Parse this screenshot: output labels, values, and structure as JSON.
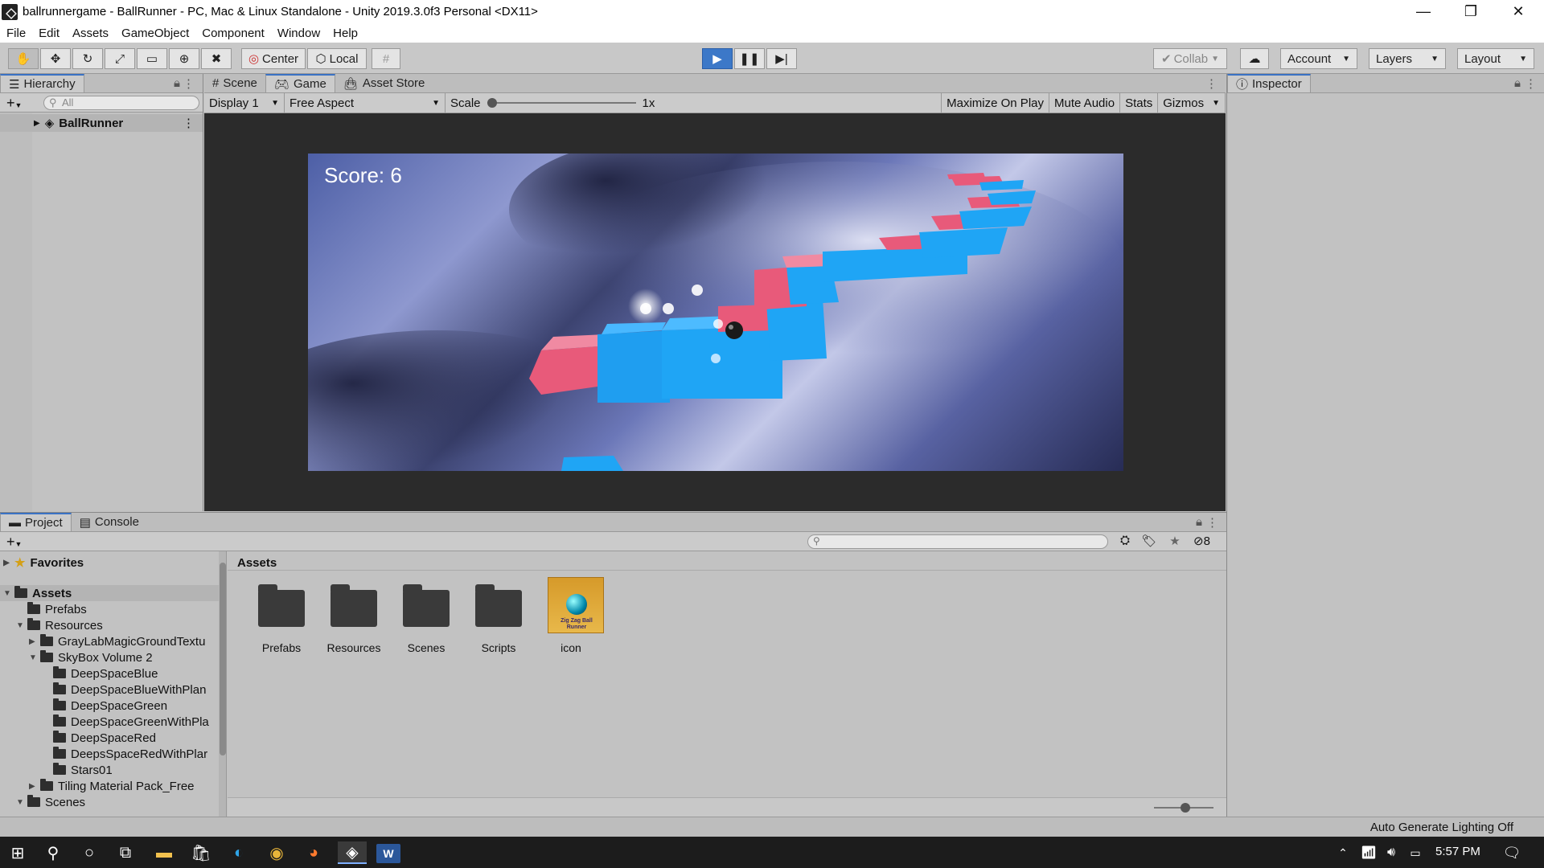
{
  "window": {
    "title": "ballrunnergame - BallRunner - PC, Mac & Linux Standalone - Unity 2019.3.0f3 Personal <DX11>",
    "minimize": "—",
    "maximize": "❐",
    "close": "✕"
  },
  "menu": [
    "File",
    "Edit",
    "Assets",
    "GameObject",
    "Component",
    "Window",
    "Help"
  ],
  "toolbar": {
    "tools": [
      "hand-tool-icon",
      "move-tool-icon",
      "rotate-tool-icon",
      "scale-tool-icon",
      "rect-tool-icon",
      "transform-tool-icon",
      "custom-tool-icon"
    ],
    "pivot_label": "Center",
    "space_label": "Local",
    "collab_label": "Collab",
    "account_label": "Account",
    "layers_label": "Layers",
    "layout_label": "Layout"
  },
  "hierarchy": {
    "tab": "Hierarchy",
    "search_placeholder": "All",
    "scene": "BallRunner"
  },
  "game": {
    "tabs": [
      "Scene",
      "Game",
      "Asset Store"
    ],
    "active_tab": "Game",
    "display": "Display 1",
    "aspect": "Free Aspect",
    "scale_label": "Scale",
    "scale_value": "1x",
    "scale_fraction": 0.0,
    "maximize": "Maximize On Play",
    "mute": "Mute Audio",
    "stats": "Stats",
    "gizmos": "Gizmos",
    "score_text": "Score: 6"
  },
  "inspector": {
    "tab": "Inspector"
  },
  "project": {
    "tabs": [
      "Project",
      "Console"
    ],
    "hidden_count": "8",
    "favorites": "Favorites",
    "tree": [
      {
        "label": "Assets",
        "depth": 0,
        "arrow": "▼",
        "folder": true
      },
      {
        "label": "Prefabs",
        "depth": 1,
        "arrow": "",
        "folder": true
      },
      {
        "label": "Resources",
        "depth": 1,
        "arrow": "▼",
        "folder": true
      },
      {
        "label": "GrayLabMagicGroundTextu",
        "depth": 2,
        "arrow": "▶",
        "folder": true
      },
      {
        "label": "SkyBox Volume 2",
        "depth": 2,
        "arrow": "▼",
        "folder": true
      },
      {
        "label": "DeepSpaceBlue",
        "depth": 3,
        "arrow": "",
        "folder": true
      },
      {
        "label": "DeepSpaceBlueWithPlan",
        "depth": 3,
        "arrow": "",
        "folder": true
      },
      {
        "label": "DeepSpaceGreen",
        "depth": 3,
        "arrow": "",
        "folder": true
      },
      {
        "label": "DeepSpaceGreenWithPla",
        "depth": 3,
        "arrow": "",
        "folder": true
      },
      {
        "label": "DeepSpaceRed",
        "depth": 3,
        "arrow": "",
        "folder": true
      },
      {
        "label": "DeepsSpaceRedWithPlar",
        "depth": 3,
        "arrow": "",
        "folder": true
      },
      {
        "label": "Stars01",
        "depth": 3,
        "arrow": "",
        "folder": true
      },
      {
        "label": "Tiling Material Pack_Free",
        "depth": 2,
        "arrow": "▶",
        "folder": true
      },
      {
        "label": "Scenes",
        "depth": 1,
        "arrow": "▼",
        "folder": true
      }
    ],
    "breadcrumb": "Assets",
    "assets": [
      {
        "label": "Prefabs",
        "kind": "folder"
      },
      {
        "label": "Resources",
        "kind": "folder"
      },
      {
        "label": "Scenes",
        "kind": "folder"
      },
      {
        "label": "Scripts",
        "kind": "folder"
      },
      {
        "label": "icon",
        "kind": "image"
      }
    ],
    "icon_caption": "Zig Zag Ball Runner"
  },
  "status": {
    "text": "Auto Generate Lighting Off"
  },
  "taskbar": {
    "time": "5:57 PM",
    "apps": [
      "windows-start-icon",
      "search-icon",
      "cortana-icon",
      "task-view-icon",
      "file-explorer-icon",
      "store-icon",
      "edge-icon",
      "chrome-icon",
      "firefox-icon",
      "unity-icon",
      "word-icon"
    ]
  },
  "colors": {
    "accent": "#3a72c4",
    "tile_blue": "#1fa5f5",
    "tile_pink": "#e85a7a"
  }
}
